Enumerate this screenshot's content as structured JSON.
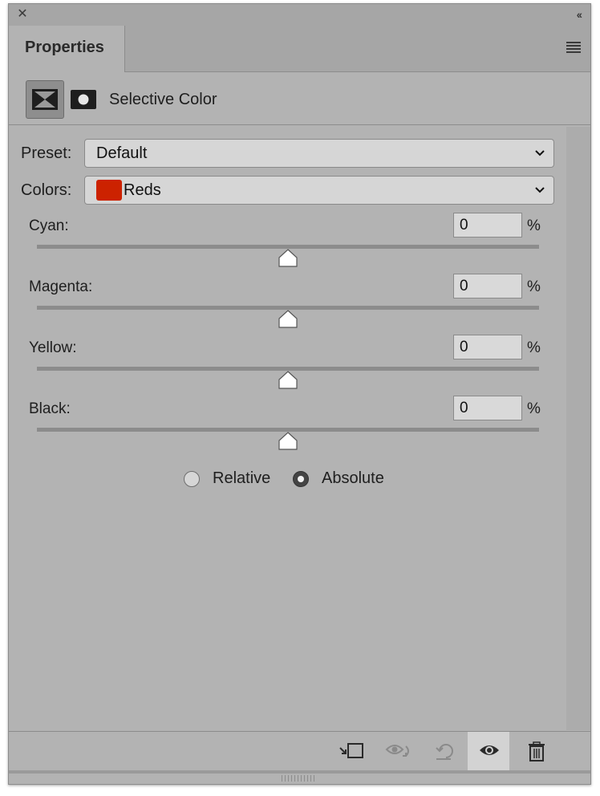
{
  "panel": {
    "tab_title": "Properties",
    "adjustment_title": "Selective Color"
  },
  "preset": {
    "label": "Preset:",
    "value": "Default"
  },
  "colors": {
    "label": "Colors:",
    "value": "Reds",
    "swatch_color": "#cc2200"
  },
  "sliders": [
    {
      "label": "Cyan:",
      "value": "0",
      "unit": "%",
      "level_percent": 0,
      "range": [
        -100,
        100
      ]
    },
    {
      "label": "Magenta:",
      "value": "0",
      "unit": "%",
      "level_percent": 0,
      "range": [
        -100,
        100
      ]
    },
    {
      "label": "Yellow:",
      "value": "0",
      "unit": "%",
      "level_percent": 0,
      "range": [
        -100,
        100
      ]
    },
    {
      "label": "Black:",
      "value": "0",
      "unit": "%",
      "level_percent": 0,
      "range": [
        -100,
        100
      ]
    }
  ],
  "method": {
    "options": [
      "Relative",
      "Absolute"
    ],
    "selected": "Absolute"
  },
  "footer_icons": [
    "clip-to-layer-icon",
    "view-previous-state-icon",
    "reset-icon",
    "visibility-eye-icon",
    "trash-icon"
  ],
  "colors_theme": {
    "panel_bg": "#b3b3b3",
    "field_bg": "#d6d6d6"
  }
}
